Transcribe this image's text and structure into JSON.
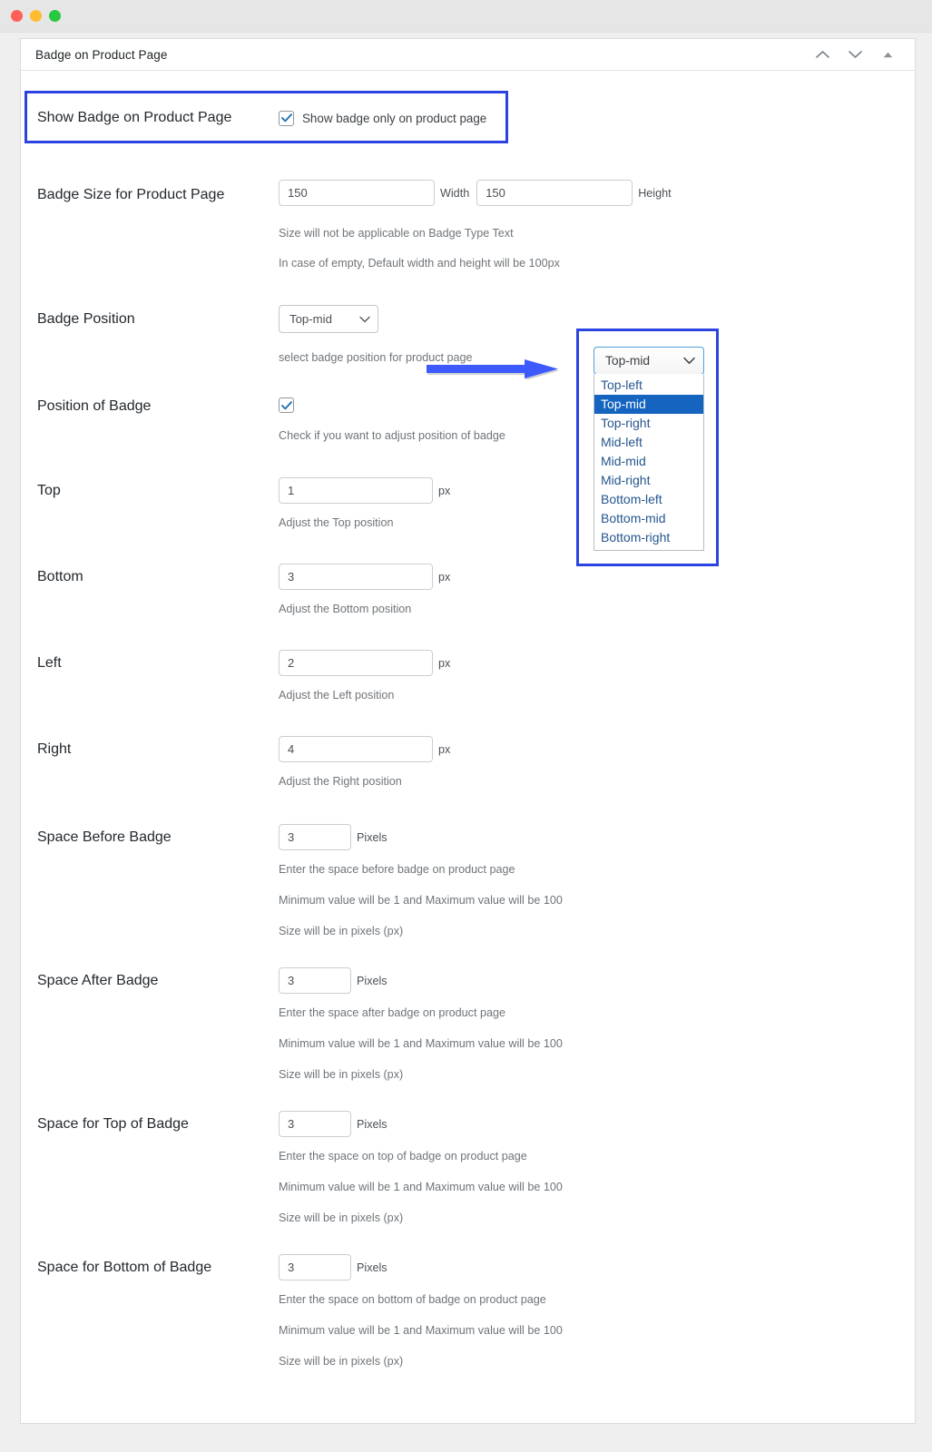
{
  "window": {
    "traffic_lights": [
      "close",
      "minimize",
      "maximize"
    ]
  },
  "panel": {
    "title": "Badge on Product Page",
    "header_actions": [
      {
        "name": "chevron-up-icon",
        "label": "Move up"
      },
      {
        "name": "chevron-down-icon",
        "label": "Move down"
      },
      {
        "name": "collapse-triangle-icon",
        "label": "Collapse"
      }
    ]
  },
  "colors": {
    "annotation_blue": "#2b44e0",
    "arrow_blue": "#3d5afe",
    "dropdown_selected_bg": "#1564c0",
    "dropdown_item_text": "#26568f",
    "checkbox_check": "#2271b1"
  },
  "sections": {
    "show_badge": {
      "label": "Show Badge on Product Page",
      "checkbox_label": "Show badge only on product page",
      "checked": true
    },
    "badge_size": {
      "label": "Badge Size for Product Page",
      "width_value": "150",
      "width_unit": "Width",
      "height_value": "150",
      "height_unit": "Height",
      "hints": [
        "Size will not be applicable on Badge Type Text",
        "In case of empty, Default width and height will be 100px"
      ]
    },
    "badge_position": {
      "label": "Badge Position",
      "selected": "Top-mid",
      "hint": "select badge position for product page",
      "options": [
        "Top-left",
        "Top-mid",
        "Top-right",
        "Mid-left",
        "Mid-mid",
        "Mid-right",
        "Bottom-left",
        "Bottom-mid",
        "Bottom-right"
      ]
    },
    "position_of_badge": {
      "label": "Position of Badge",
      "checked": true,
      "hint": "Check if you want to adjust position of badge"
    },
    "top": {
      "label": "Top",
      "value": "1",
      "unit": "px",
      "hint": "Adjust the Top position"
    },
    "bottom": {
      "label": "Bottom",
      "value": "3",
      "unit": "px",
      "hint": "Adjust the Bottom position"
    },
    "left": {
      "label": "Left",
      "value": "2",
      "unit": "px",
      "hint": "Adjust the Left position"
    },
    "right": {
      "label": "Right",
      "value": "4",
      "unit": "px",
      "hint": "Adjust the Right position"
    },
    "space_before": {
      "label": "Space Before Badge",
      "value": "3",
      "unit": "Pixels",
      "hints": [
        "Enter the space before badge on product page",
        "Minimum value will be 1 and Maximum value will be 100",
        "Size will be in pixels (px)"
      ]
    },
    "space_after": {
      "label": "Space After Badge",
      "value": "3",
      "unit": "Pixels",
      "hints": [
        "Enter the space after badge on product page",
        "Minimum value will be 1 and Maximum value will be 100",
        "Size will be in pixels (px)"
      ]
    },
    "space_top": {
      "label": "Space for Top of Badge",
      "value": "3",
      "unit": "Pixels",
      "hints": [
        "Enter the space on top of badge on product page",
        "Minimum value will be 1 and Maximum value will be 100",
        "Size will be in pixels (px)"
      ]
    },
    "space_bottom": {
      "label": "Space for Bottom of Badge",
      "value": "3",
      "unit": "Pixels",
      "hints": [
        "Enter the space on bottom of badge on product page",
        "Minimum value will be 1 and Maximum value will be 100",
        "Size will be in pixels (px)"
      ]
    }
  }
}
